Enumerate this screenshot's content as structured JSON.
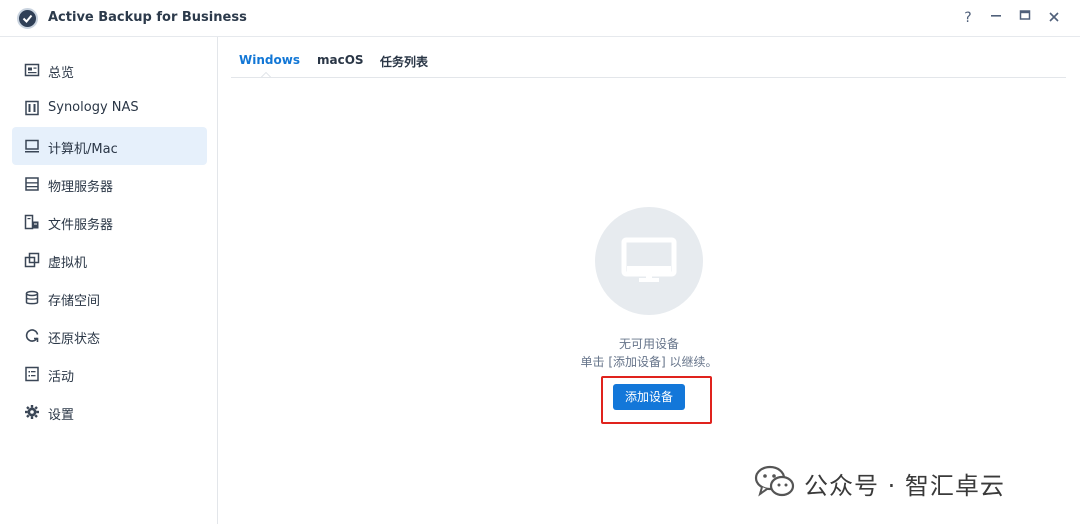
{
  "app": {
    "title": "Active Backup for Business"
  },
  "window_controls": {
    "help": "?",
    "minimize": "—",
    "maximize": "▣",
    "close": "✕"
  },
  "sidebar": {
    "items": [
      {
        "label": "总览",
        "icon": "overview-icon",
        "active": false
      },
      {
        "label": "Synology NAS",
        "icon": "nas-icon",
        "active": false
      },
      {
        "label": "计算机/Mac",
        "icon": "computer-icon",
        "active": true
      },
      {
        "label": "物理服务器",
        "icon": "server-icon",
        "active": false
      },
      {
        "label": "文件服务器",
        "icon": "file-server-icon",
        "active": false
      },
      {
        "label": "虚拟机",
        "icon": "virtual-machine-icon",
        "active": false
      },
      {
        "label": "存储空间",
        "icon": "storage-icon",
        "active": false
      },
      {
        "label": "还原状态",
        "icon": "restore-icon",
        "active": false
      },
      {
        "label": "活动",
        "icon": "activity-icon",
        "active": false
      },
      {
        "label": "设置",
        "icon": "gear-icon",
        "active": false
      }
    ]
  },
  "tabs": [
    {
      "label": "Windows",
      "active": true
    },
    {
      "label": "macOS",
      "active": false
    },
    {
      "label": "任务列表",
      "active": false
    }
  ],
  "empty_state": {
    "icon": "monitor-icon",
    "title": "无可用设备",
    "hint": "单击 [添加设备] 以继续。",
    "button_label": "添加设备"
  },
  "watermark": {
    "text": "公众号 · 智汇卓云",
    "icon": "wechat-icon"
  },
  "colors": {
    "accent": "#1377d9",
    "active_bg": "#e6f0fb",
    "highlight": "#e0231d"
  }
}
